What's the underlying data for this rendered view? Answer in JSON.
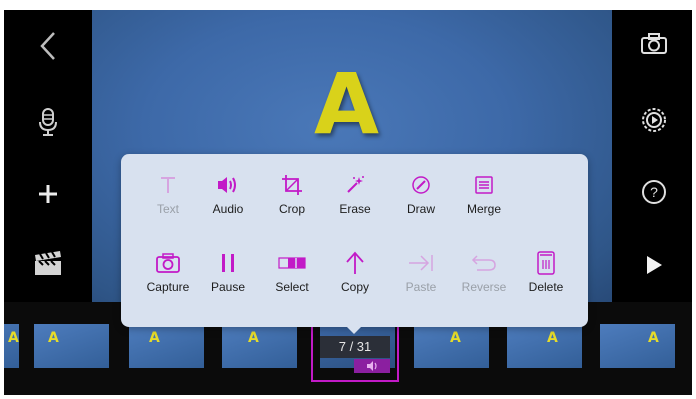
{
  "video": {
    "letter": "A"
  },
  "left_toolbar": [
    "back-icon",
    "microphone-icon",
    "add-icon",
    "clapperboard-icon"
  ],
  "right_toolbar": [
    "camera-icon",
    "settings-icon",
    "help-icon",
    "play-icon"
  ],
  "help_glyph": "?",
  "context_menu": {
    "row1": [
      {
        "label": "Text",
        "icon": "text-icon",
        "enabled": false
      },
      {
        "label": "Audio",
        "icon": "audio-icon",
        "enabled": true
      },
      {
        "label": "Crop",
        "icon": "crop-icon",
        "enabled": true
      },
      {
        "label": "Erase",
        "icon": "magic-wand-icon",
        "enabled": true
      },
      {
        "label": "Draw",
        "icon": "pen-icon",
        "enabled": true
      },
      {
        "label": "Merge",
        "icon": "merge-icon",
        "enabled": true
      }
    ],
    "row2": [
      {
        "label": "Capture",
        "icon": "camera-icon",
        "enabled": true
      },
      {
        "label": "Pause",
        "icon": "pause-icon",
        "enabled": true
      },
      {
        "label": "Select",
        "icon": "select-icon",
        "enabled": true
      },
      {
        "label": "Copy",
        "icon": "arrow-up-icon",
        "enabled": true
      },
      {
        "label": "Paste",
        "icon": "paste-icon",
        "enabled": false
      },
      {
        "label": "Reverse",
        "icon": "undo-icon",
        "enabled": false
      },
      {
        "label": "Delete",
        "icon": "trash-icon",
        "enabled": true
      }
    ]
  },
  "timeline": {
    "thumbnail_letter": "A",
    "frame_counter": "7 / 31",
    "selection_color": "#c21ac7"
  },
  "colors": {
    "accent": "#c21ac7",
    "disabled": "#d6a4e0",
    "menu_bg": "#d8e1ef"
  }
}
